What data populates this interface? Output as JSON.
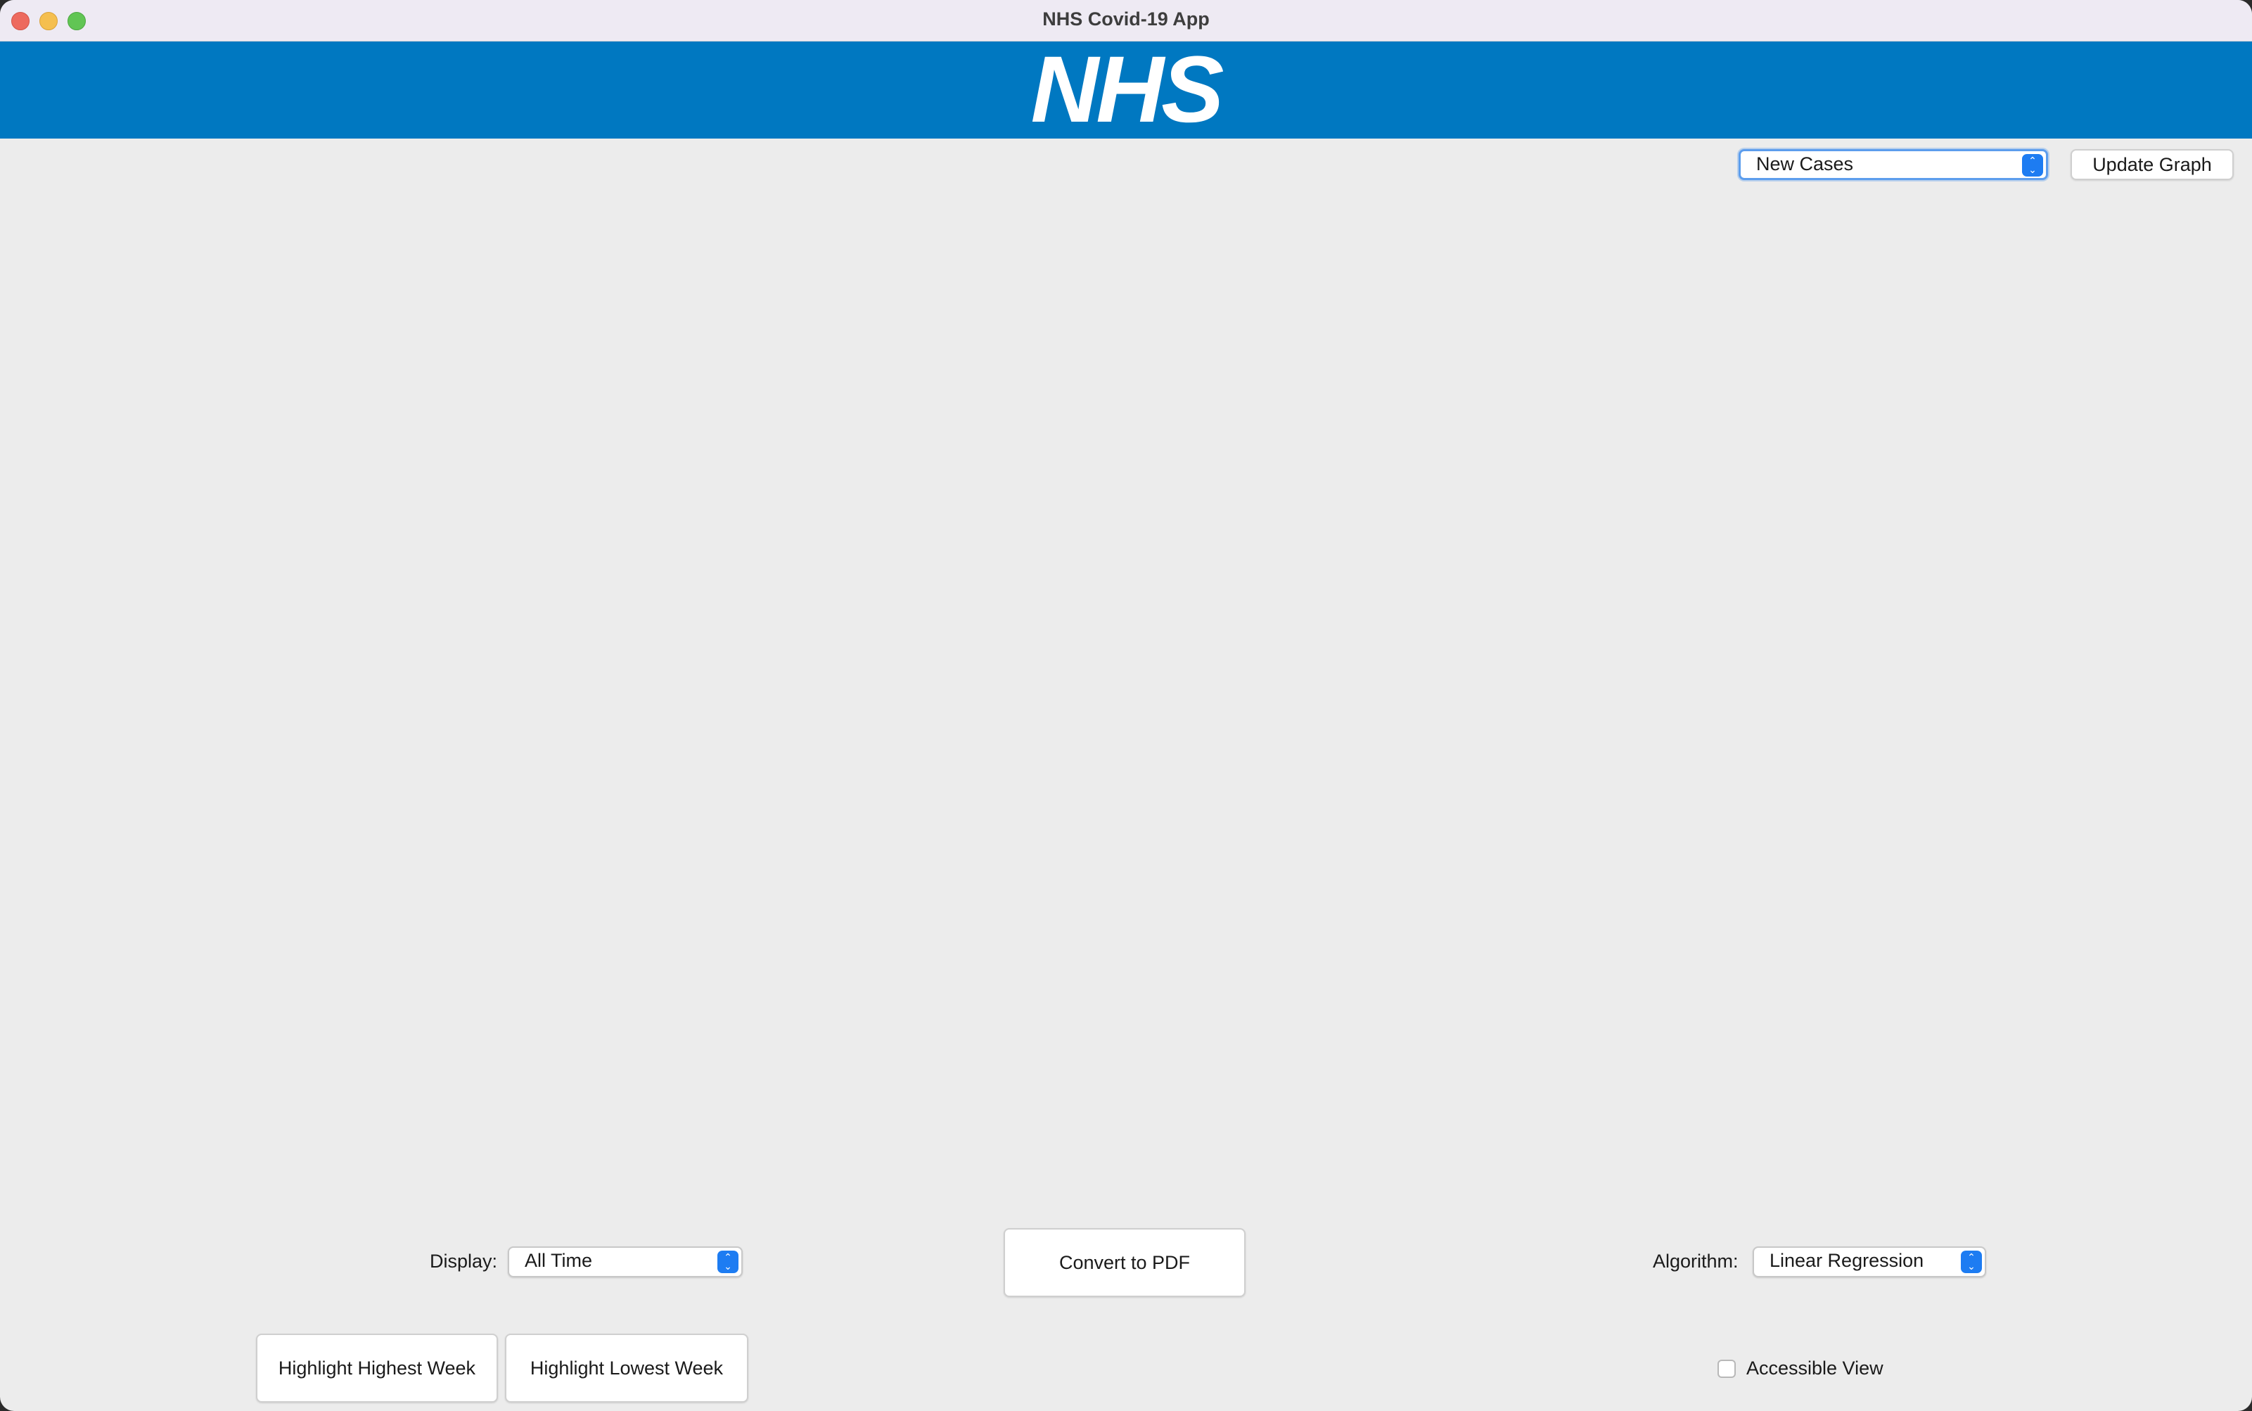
{
  "window": {
    "title": "NHS Covid-19 App"
  },
  "banner": {
    "logo_text": "NHS",
    "color": "#0078c1"
  },
  "top_controls": {
    "metric_select": "New Cases",
    "update_button": "Update Graph"
  },
  "bottom_controls": {
    "display_label": "Display:",
    "display_select": "All Time",
    "convert_button": "Convert to PDF",
    "algorithm_label": "Algorithm:",
    "algorithm_select": "Linear Regression",
    "highlight_highest_button": "Highlight Highest Week",
    "highlight_lowest_button": "Highlight Lowest Week",
    "accessible_view_label": "Accessible View",
    "accessible_view_checked": false
  },
  "icons": {
    "select_chevron": "up-down-chevron-icon"
  }
}
